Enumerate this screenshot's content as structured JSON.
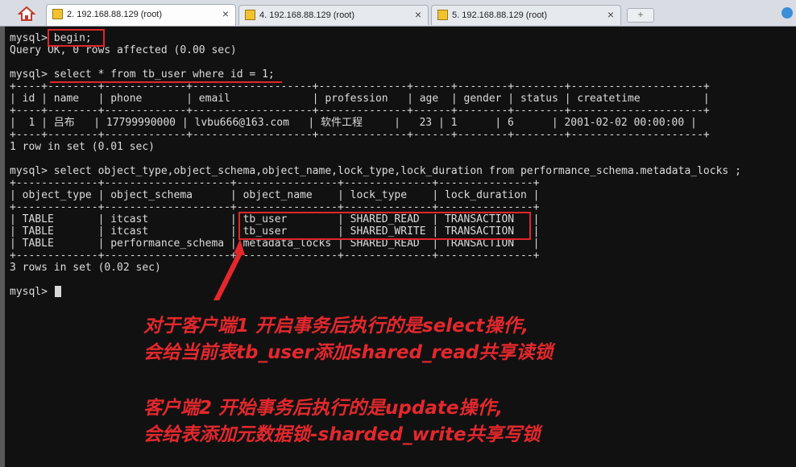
{
  "tabs": [
    {
      "label": "2. 192.168.88.129 (root)",
      "close": "×",
      "icon": "key-icon"
    },
    {
      "label": "4. 192.168.88.129 (root)",
      "close": "×",
      "icon": "key-icon"
    },
    {
      "label": "5. 192.168.88.129 (root)",
      "close": "×",
      "icon": "key-icon"
    }
  ],
  "new_tab_label": "+",
  "terminal": {
    "lines": [
      "mysql> begin;",
      "Query OK, 0 rows affected (0.00 sec)",
      "",
      "mysql> select * from tb_user where id = 1;",
      "+----+--------+-------------+-------------------+--------------+------+--------+--------+---------------------+",
      "| id | name   | phone       | email             | profession   | age  | gender | status | createtime          |",
      "+----+--------+-------------+-------------------+--------------+------+--------+--------+---------------------+",
      "|  1 | 吕布   | 17799990000 | lvbu666@163.com   | 软件工程     |   23 | 1      | 6      | 2001-02-02 00:00:00 |",
      "+----+--------+-------------+-------------------+--------------+------+--------+--------+---------------------+",
      "1 row in set (0.01 sec)",
      "",
      "mysql> select object_type,object_schema,object_name,lock_type,lock_duration from performance_schema.metadata_locks ;",
      "+-------------+--------------------+----------------+--------------+---------------+",
      "| object_type | object_schema      | object_name    | lock_type    | lock_duration |",
      "+-------------+--------------------+----------------+--------------+---------------+",
      "| TABLE       | itcast             | tb_user        | SHARED_READ  | TRANSACTION   |",
      "| TABLE       | itcast             | tb_user        | SHARED_WRITE | TRANSACTION   |",
      "| TABLE       | performance_schema | metadata_locks | SHARED_READ  | TRANSACTION   |",
      "+-------------+--------------------+----------------+--------------+---------------+",
      "3 rows in set (0.02 sec)",
      "",
      "mysql> "
    ]
  },
  "annotations": [
    "对于客户端1 开启事务后执行的是select操作,",
    "会给当前表tb_user添加shared_read共享读锁",
    "客户端2 开始事务后执行的是update操作,",
    "会给表添加元数据锁-sharded_write共享写锁"
  ],
  "colors": {
    "terminal_bg": "#111111",
    "terminal_text": "#dcdcdc",
    "highlight_red": "#e0262b"
  }
}
